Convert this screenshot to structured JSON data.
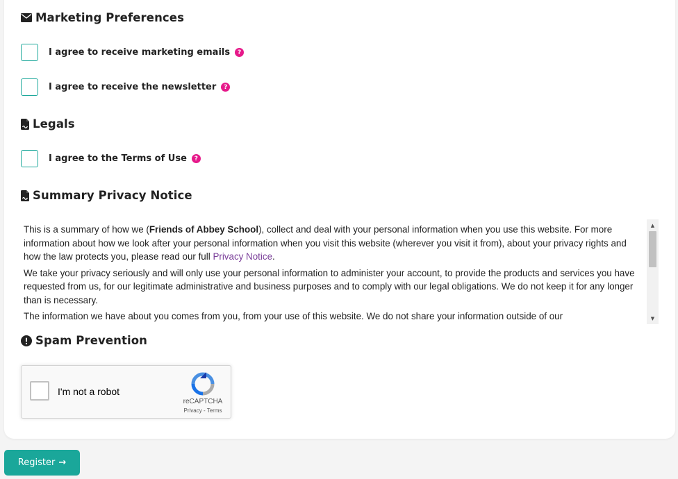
{
  "marketing": {
    "heading": "Marketing Preferences",
    "icon": "envelope-icon",
    "options": [
      {
        "label": "I agree to receive marketing emails",
        "help": "?"
      },
      {
        "label": "I agree to receive the newsletter",
        "help": "?"
      }
    ]
  },
  "legals": {
    "heading": "Legals",
    "icon": "file-contract-icon",
    "options": [
      {
        "label": "I agree to the Terms of Use",
        "help": "?"
      }
    ]
  },
  "privacy": {
    "heading": "Summary Privacy Notice",
    "icon": "file-contract-icon",
    "p1_before": "This is a summary of how we (",
    "org_name": "Friends of Abbey School",
    "p1_after": "), collect and deal with your personal information when you use this website. For more information about how we look after your personal information when you visit this website (wherever you visit it from), about your privacy rights and how the law protects you, please read our full ",
    "link": "Privacy Notice",
    "p1_end": ".",
    "p2": "We take your privacy seriously and will only use your personal information to administer your account, to provide the products and services you have requested from us, for our legitimate administrative and business purposes and to comply with our legal obligations. We do not keep it for any longer than is necessary.",
    "p3": "The information we have about you comes from you, from your use of this website. We do not share your information outside of our"
  },
  "spam": {
    "heading": "Spam Prevention",
    "icon": "exclamation-circle-icon"
  },
  "recaptcha": {
    "label": "I'm not a robot",
    "brand": "reCAPTCHA",
    "links": "Privacy - Terms"
  },
  "register": {
    "label": "Register",
    "arrow": "→"
  },
  "colors": {
    "accent": "#1aa79a",
    "help": "#e6198a",
    "link": "#7a3e99"
  }
}
